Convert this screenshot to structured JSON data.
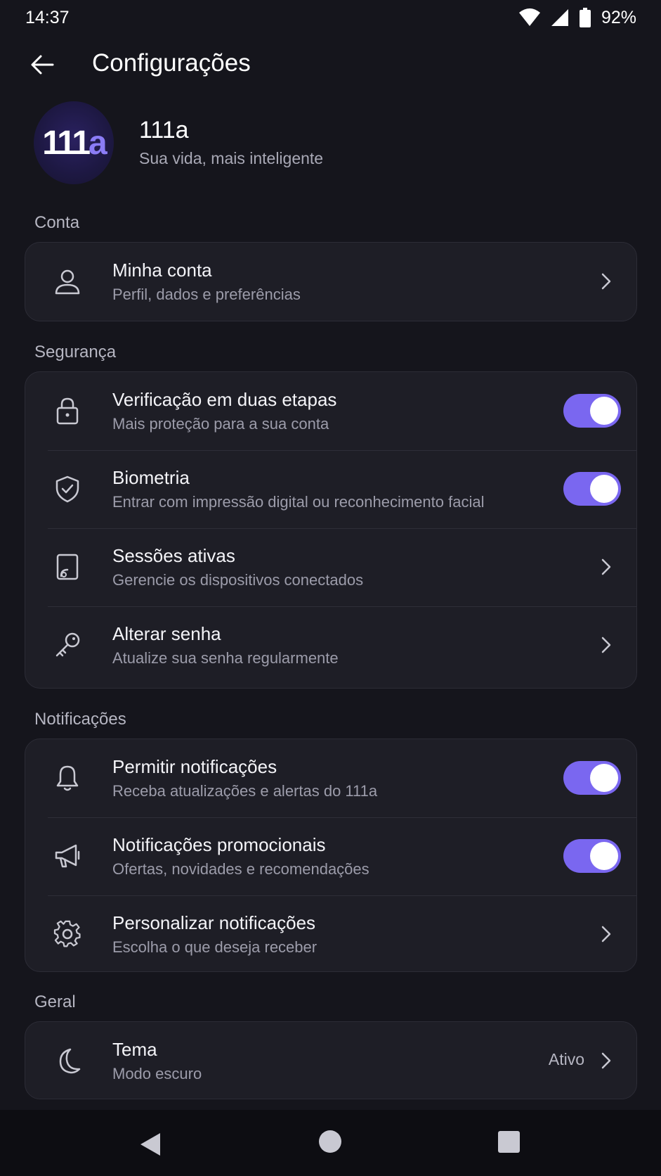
{
  "status_bar": {
    "time": "14:37",
    "battery": "92%"
  },
  "app_bar": {
    "title": "Configurações"
  },
  "brand": {
    "logo_main": "111",
    "logo_accent": "a",
    "name": "111a",
    "tagline": "Sua vida, mais inteligente"
  },
  "colors": {
    "background": "#15151c",
    "card": "#1e1e26",
    "accent": "#7a67f0"
  },
  "sections": {
    "conta": {
      "label": "Conta",
      "items": [
        {
          "icon": "user-icon",
          "title": "Minha conta",
          "subtitle": "Perfil, dados e preferências",
          "control": "chevron"
        }
      ]
    },
    "seguranca": {
      "label": "Segurança",
      "items": [
        {
          "icon": "lock-icon",
          "title": "Verificação em duas etapas",
          "subtitle": "Mais proteção para a sua conta",
          "control": "toggle",
          "enabled": true
        },
        {
          "icon": "shield-check-icon",
          "title": "Biometria",
          "subtitle": "Entrar com impressão digital ou reconhecimento facial",
          "control": "toggle",
          "enabled": true
        },
        {
          "icon": "device-icon",
          "title": "Sessões ativas",
          "subtitle": "Gerencie os dispositivos conectados",
          "control": "chevron"
        },
        {
          "icon": "key-icon",
          "title": "Alterar senha",
          "subtitle": "Atualize sua senha regularmente",
          "control": "chevron"
        }
      ]
    },
    "notificacoes": {
      "label": "Notificações",
      "items": [
        {
          "icon": "bell-icon",
          "title": "Permitir notificações",
          "subtitle": "Receba atualizações e alertas do 111a",
          "control": "toggle",
          "enabled": true
        },
        {
          "icon": "megaphone-icon",
          "title": "Notificações promocionais",
          "subtitle": "Ofertas, novidades e recomendações",
          "control": "toggle",
          "enabled": true
        },
        {
          "icon": "gear-icon",
          "title": "Personalizar notificações",
          "subtitle": "Escolha o que deseja receber",
          "control": "chevron"
        }
      ]
    },
    "geral": {
      "label": "Geral",
      "items": [
        {
          "icon": "moon-icon",
          "title": "Tema",
          "subtitle": "Modo escuro",
          "value": "Ativo",
          "control": "chevron"
        }
      ]
    }
  },
  "nav_bar": {
    "buttons": [
      "back-triangle-icon",
      "home-circle-icon",
      "recents-square-icon"
    ]
  }
}
